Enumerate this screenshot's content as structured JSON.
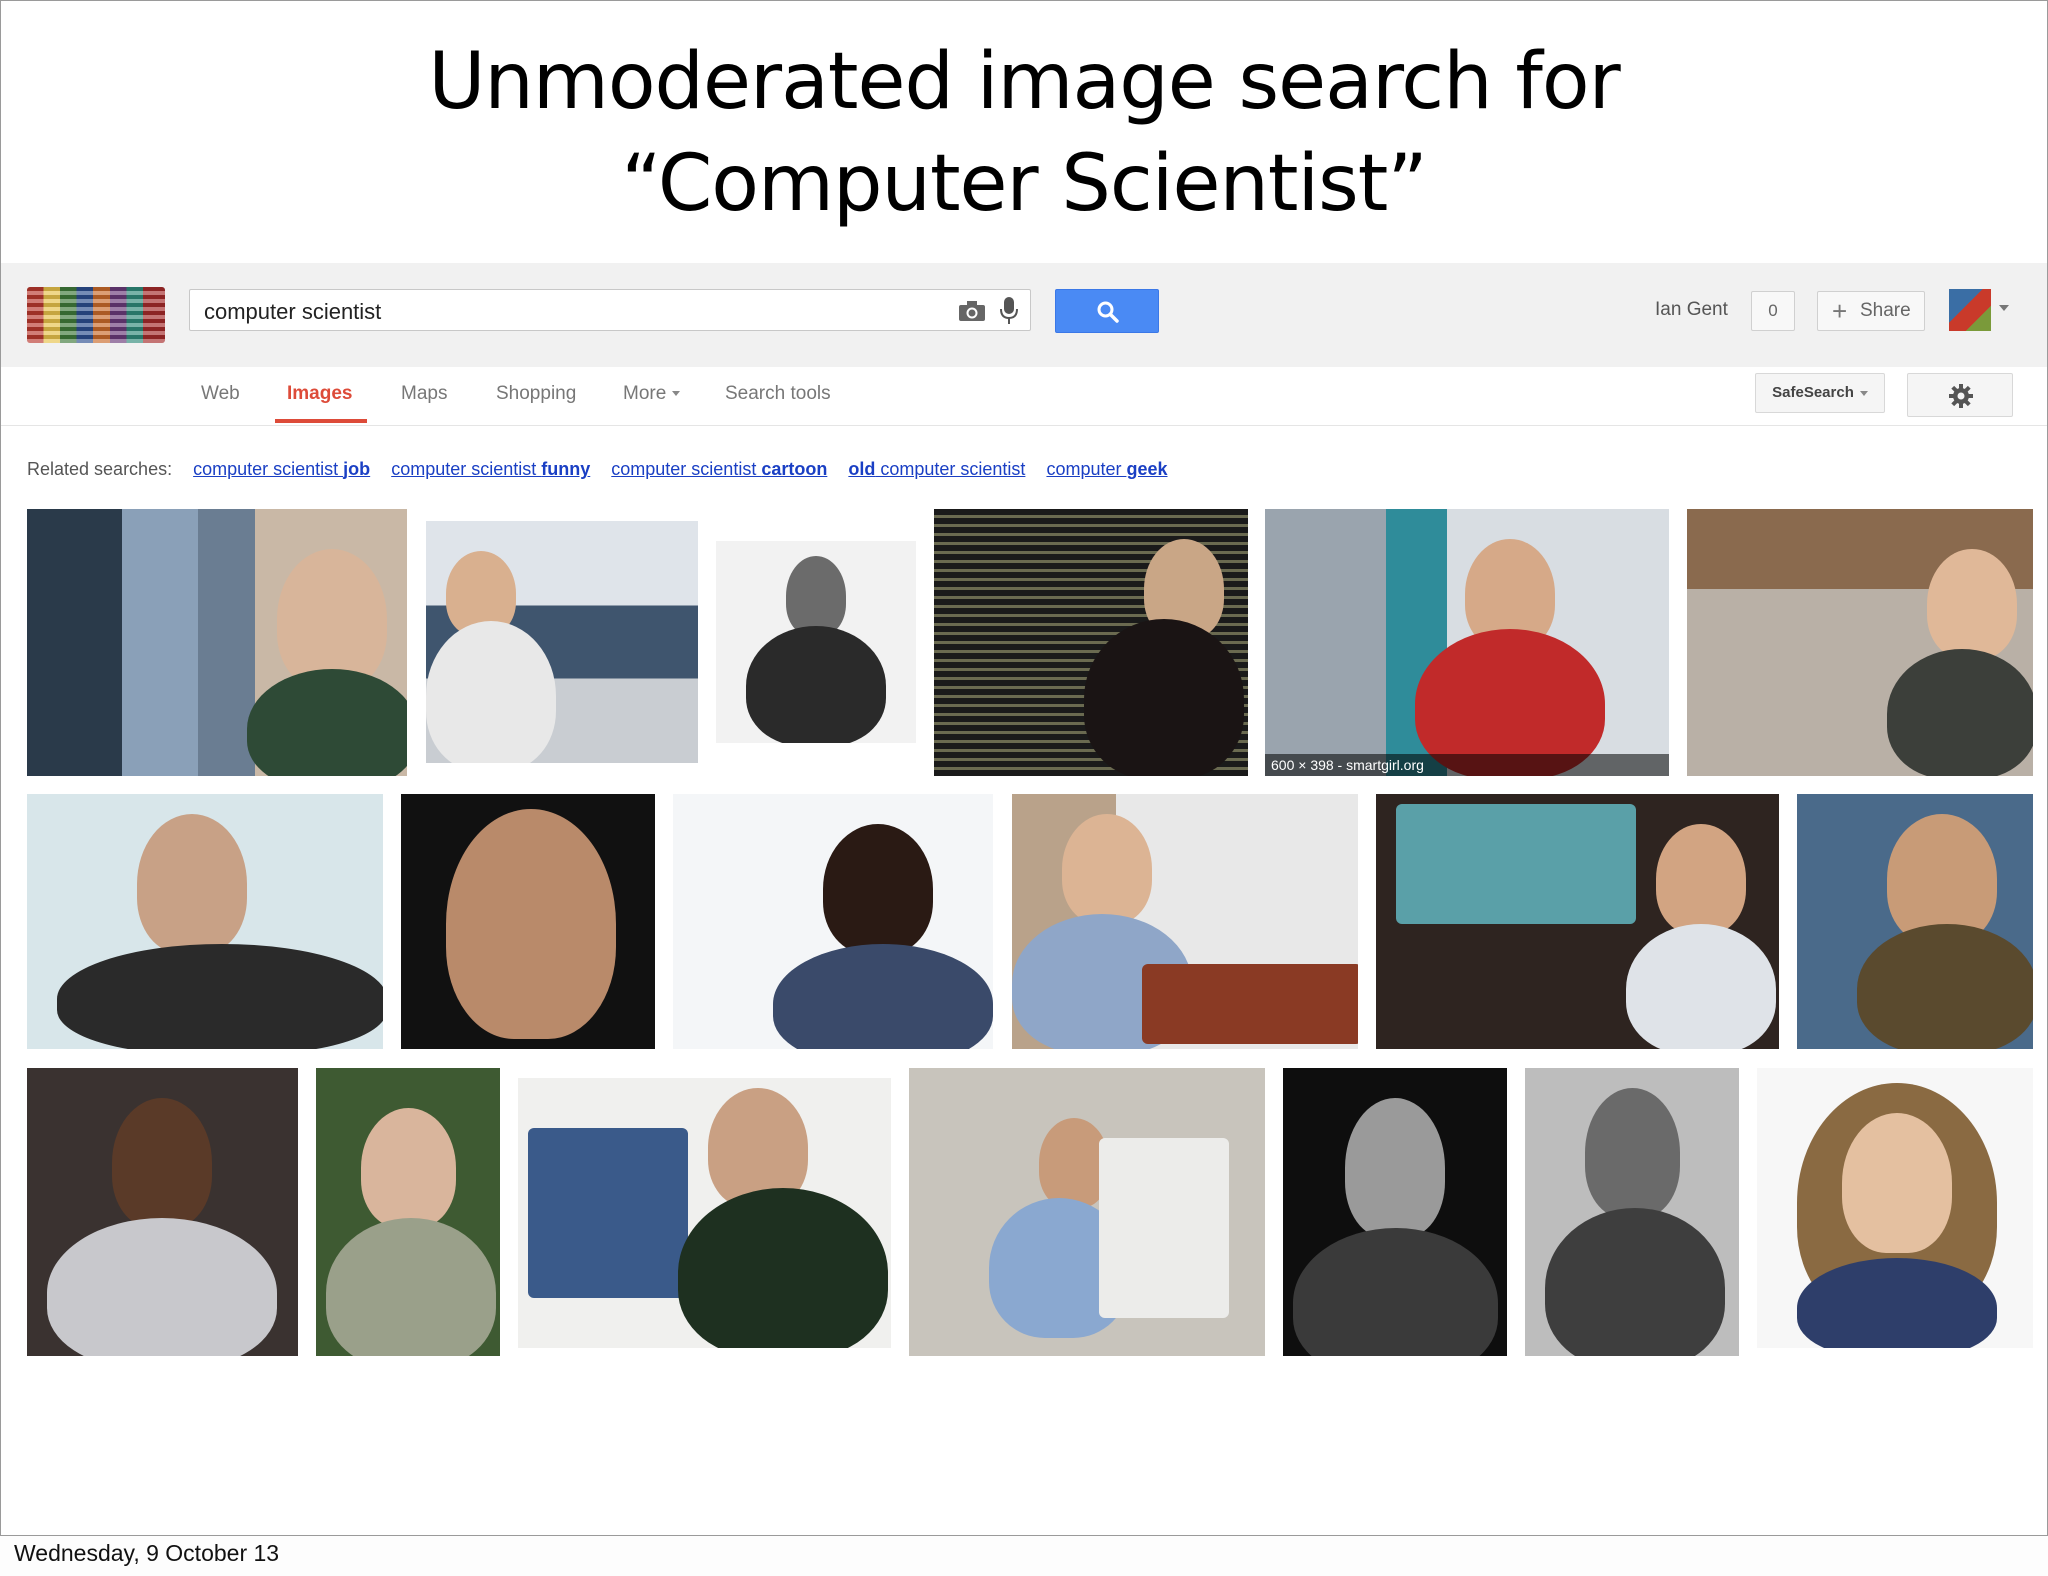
{
  "slide": {
    "title_line1": "Unmoderated image search for",
    "title_line2": "“Computer Scientist”",
    "footer_date": "Wednesday, 9 October 13"
  },
  "search": {
    "query": "computer scientist",
    "camera_icon": "camera-icon",
    "mic_icon": "microphone-icon",
    "search_icon": "magnifier-icon",
    "button_color": "#4a8af4"
  },
  "account": {
    "user_name": "Ian Gent",
    "notification_count": "0",
    "share_label": "Share"
  },
  "nav": {
    "items": [
      {
        "label": "Web"
      },
      {
        "label": "Images"
      },
      {
        "label": "Maps"
      },
      {
        "label": "Shopping"
      },
      {
        "label": "More"
      },
      {
        "label": "Search tools"
      }
    ],
    "active": "Images",
    "active_color": "#dd4b39",
    "safesearch_label": "SafeSearch"
  },
  "related": {
    "label": "Related searches:",
    "links": [
      {
        "normal": "computer scientist ",
        "bold": "job"
      },
      {
        "normal": "computer scientist ",
        "bold": "funny"
      },
      {
        "normal": "computer scientist ",
        "bold": "cartoon"
      },
      {
        "normal": " computer scientist",
        "bold": "old"
      },
      {
        "normal": "computer ",
        "bold": "geek"
      }
    ]
  },
  "results": {
    "hover_caption": "600 × 398 - smartgirl.org",
    "count": 19
  }
}
